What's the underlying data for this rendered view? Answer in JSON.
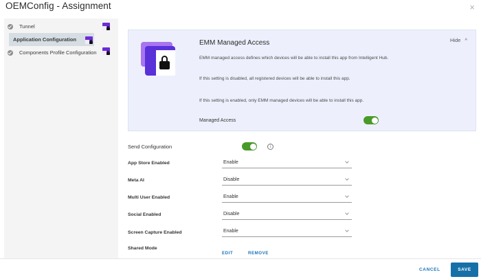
{
  "window": {
    "title": "OEMConfig - Assignment",
    "close_glyph": "×"
  },
  "sidebar": {
    "items": [
      {
        "label": "Tunnel",
        "state": "complete",
        "badge": "lock-badge"
      },
      {
        "label": "Application Configuration",
        "state": "active",
        "badge": "lock-badge"
      },
      {
        "label": "Components Profile Configuration",
        "state": "complete",
        "badge": "lock-badge"
      }
    ]
  },
  "emm": {
    "title": "EMM Managed Access",
    "hide_label": "Hide",
    "hide_chevron": "^",
    "paragraphs": [
      "EMM managed access defines which devices will be able to install this app from Intelligent Hub.",
      "If this setting is disabled, all registered devices will be able to install this app.",
      "If this setting is enabled, only EMM managed devices will be able to install this app."
    ],
    "managed_access_label": "Managed Access",
    "managed_access_enabled": true,
    "illustration_icon": "lock-icon"
  },
  "form": {
    "send_configuration": {
      "label": "Send Configuration",
      "enabled": true,
      "info_glyph": "i"
    },
    "fields": [
      {
        "label": "App Store Enabled",
        "value": "Enable"
      },
      {
        "label": "Meta AI",
        "value": "Disable"
      },
      {
        "label": "Multi User Enabled",
        "value": "Enable"
      },
      {
        "label": "Social Enabled",
        "value": "Disable"
      },
      {
        "label": "Screen Capture Enabled",
        "value": "Enable"
      }
    ],
    "shared_mode": {
      "label": "Shared Mode",
      "edit_label": "EDIT",
      "remove_label": "REMOVE"
    }
  },
  "footer": {
    "cancel_label": "CANCEL",
    "save_label": "SAVE"
  },
  "colors": {
    "accent": "#1670a8",
    "link": "#1a73b8",
    "toggle_on": "#4a9a2a",
    "badge": "#6c2cd6",
    "panel_bg": "#edf0fc"
  }
}
